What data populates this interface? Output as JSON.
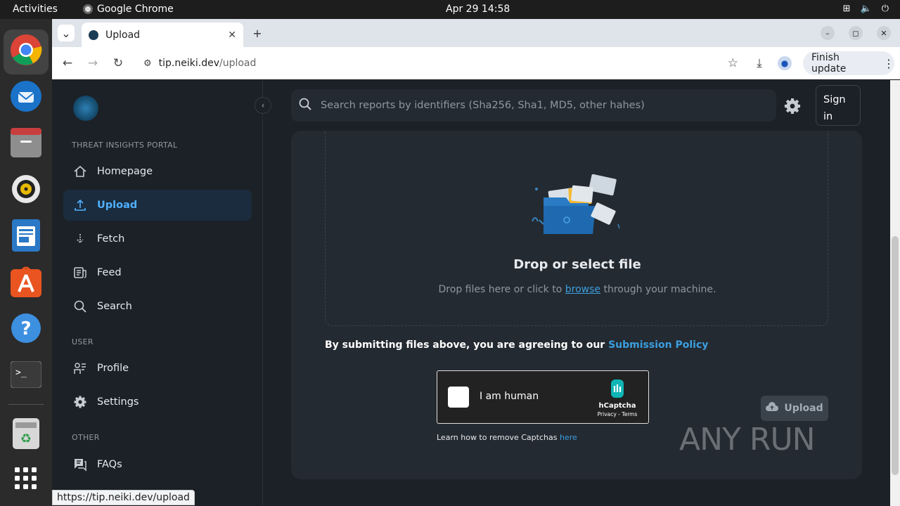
{
  "topbar": {
    "activities": "Activities",
    "app_name": "Google Chrome",
    "clock": "Apr 29  14:58"
  },
  "dock": {
    "items": [
      "chrome",
      "thunderbird",
      "files",
      "rhythmbox",
      "writer",
      "app-center",
      "help",
      "terminal",
      "trash",
      "show-apps"
    ]
  },
  "browser": {
    "tab_title": "Upload",
    "url_host": "tip.neiki.dev",
    "url_path": "/upload",
    "finish_update": "Finish update"
  },
  "sidebar": {
    "section_portal": "THREAT INSIGHTS PORTAL",
    "section_user": "USER",
    "section_other": "OTHER",
    "items": [
      {
        "label": "Homepage",
        "icon": "home-icon"
      },
      {
        "label": "Upload",
        "icon": "upload-icon"
      },
      {
        "label": "Fetch",
        "icon": "download-icon"
      },
      {
        "label": "Feed",
        "icon": "feed-icon"
      },
      {
        "label": "Search",
        "icon": "search-icon"
      },
      {
        "label": "Profile",
        "icon": "profile-icon"
      },
      {
        "label": "Settings",
        "icon": "gear-icon"
      },
      {
        "label": "FAQs",
        "icon": "faq-icon"
      }
    ]
  },
  "header": {
    "search_placeholder": "Search reports by identifiers (Sha256, Sha1, MD5, other hahes)",
    "signin_line1": "Sign",
    "signin_line2": "in"
  },
  "upload": {
    "drop_title": "Drop or select file",
    "drop_hint_pre": "Drop files here or click to ",
    "drop_hint_link": "browse",
    "drop_hint_post": " through your machine.",
    "agree_text": "By submitting files above, you are agreeing to our ",
    "agree_link": "Submission Policy",
    "captcha_label": "I am human",
    "captcha_brand": "hCaptcha",
    "captcha_terms": "Privacy - Terms",
    "captcha_help": "Learn how to remove Captchas ",
    "captcha_help_link": "here",
    "upload_button": "Upload"
  },
  "status_url": "https://tip.neiki.dev/upload",
  "watermark": "ANY RUN"
}
